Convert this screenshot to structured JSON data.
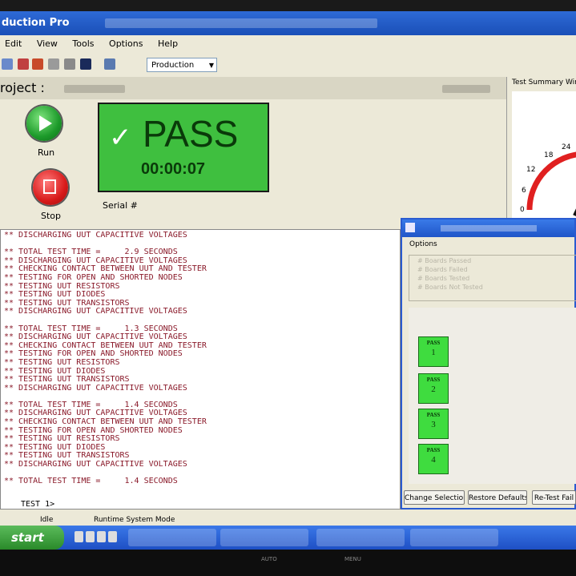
{
  "window": {
    "title": "duction Pro"
  },
  "menu": [
    "Edit",
    "View",
    "Tools",
    "Options",
    "Help"
  ],
  "toolbar": {
    "mode_select": "Production"
  },
  "project": {
    "label": "roject :"
  },
  "controls": {
    "run_label": "Run",
    "stop_label": "Stop",
    "serial_label": "Serial #"
  },
  "result": {
    "status": "PASS",
    "elapsed": "00:00:07",
    "color": "#3fbf3f"
  },
  "console_lines": [
    "** DISCHARGING UUT CAPACITIVE VOLTAGES",
    "",
    "** TOTAL TEST TIME =     2.9 SECONDS",
    "** DISCHARGING UUT CAPACITIVE VOLTAGES",
    "** CHECKING CONTACT BETWEEN UUT AND TESTER",
    "** TESTING FOR OPEN AND SHORTED NODES",
    "** TESTING UUT RESISTORS",
    "** TESTING UUT DIODES",
    "** TESTING UUT TRANSISTORS",
    "** DISCHARGING UUT CAPACITIVE VOLTAGES",
    "",
    "** TOTAL TEST TIME =     1.3 SECONDS",
    "** DISCHARGING UUT CAPACITIVE VOLTAGES",
    "** CHECKING CONTACT BETWEEN UUT AND TESTER",
    "** TESTING FOR OPEN AND SHORTED NODES",
    "** TESTING UUT RESISTORS",
    "** TESTING UUT DIODES",
    "** TESTING UUT TRANSISTORS",
    "** DISCHARGING UUT CAPACITIVE VOLTAGES",
    "",
    "** TOTAL TEST TIME =     1.4 SECONDS",
    "** DISCHARGING UUT CAPACITIVE VOLTAGES",
    "** CHECKING CONTACT BETWEEN UUT AND TESTER",
    "** TESTING FOR OPEN AND SHORTED NODES",
    "** TESTING UUT RESISTORS",
    "** TESTING UUT DIODES",
    "** TESTING UUT TRANSISTORS",
    "** DISCHARGING UUT CAPACITIVE VOLTAGES",
    "",
    "** TOTAL TEST TIME =     1.4 SECONDS"
  ],
  "prompt": "TEST 1>",
  "statusbar": {
    "state": "Idle",
    "mode": "Runtime System Mode"
  },
  "taskbar": {
    "start_label": "start"
  },
  "summary": {
    "header": "Test Summary Wind",
    "gauge_ticks": [
      "0",
      "6",
      "12",
      "18",
      "24"
    ],
    "gauge_color": "#e02020"
  },
  "dialog": {
    "options_label": "Options",
    "option_items": [
      "# Boards Passed",
      "# Boards Failed",
      "# Boards Tested",
      "# Boards Not Tested"
    ],
    "boards": [
      {
        "status": "PASS",
        "number": "1"
      },
      {
        "status": "PASS",
        "number": "2"
      },
      {
        "status": "PASS",
        "number": "3"
      },
      {
        "status": "PASS",
        "number": "4"
      }
    ],
    "buttons": {
      "change": "Change Selection",
      "restore": "Restore Defaults",
      "retest": "Re-Test Fail"
    }
  },
  "monitor": {
    "auto": "AUTO",
    "menu": "MENU"
  }
}
